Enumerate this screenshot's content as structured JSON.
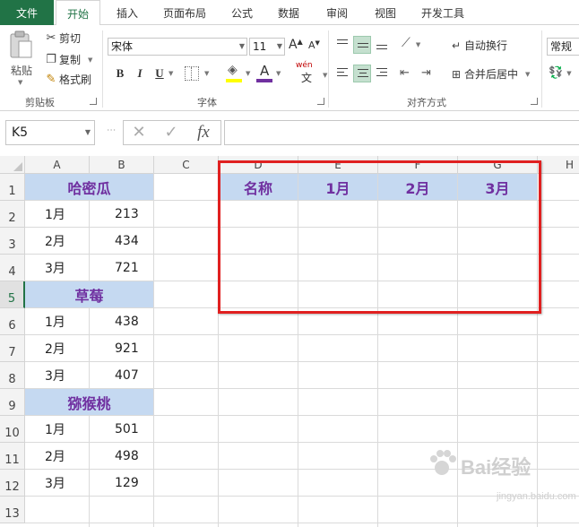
{
  "tabs": [
    "文件",
    "开始",
    "插入",
    "页面布局",
    "公式",
    "数据",
    "审阅",
    "视图",
    "开发工具"
  ],
  "clipboard": {
    "paste": "粘贴",
    "cut": "剪切",
    "copy": "复制",
    "format_painter": "格式刷",
    "label": "剪贴板"
  },
  "font": {
    "name": "宋体",
    "size": "11",
    "grow": "A",
    "shrink": "A",
    "bold": "B",
    "italic": "I",
    "underline": "U",
    "font_color_letter": "A",
    "wen": "wén",
    "wen_char": "文",
    "label": "字体",
    "font_color": "#7030a0"
  },
  "alignment": {
    "wrap_text": "自动换行",
    "merge_center": "合并后居中",
    "label": "对齐方式"
  },
  "number": {
    "format": "常规"
  },
  "formula_bar": {
    "name_box": "K5",
    "cancel": "✕",
    "enter": "✓",
    "fx": "fx",
    "content": ""
  },
  "columns": [
    "A",
    "B",
    "C",
    "D",
    "E",
    "F",
    "G",
    "H"
  ],
  "rows": [
    "1",
    "2",
    "3",
    "4",
    "5",
    "6",
    "7",
    "8",
    "9",
    "10",
    "11",
    "12",
    "13"
  ],
  "active_row": "5",
  "blocks": [
    {
      "title": "哈密瓜",
      "rows": [
        [
          "1月",
          "213"
        ],
        [
          "2月",
          "434"
        ],
        [
          "3月",
          "721"
        ]
      ]
    },
    {
      "title": "草莓",
      "rows": [
        [
          "1月",
          "438"
        ],
        [
          "2月",
          "921"
        ],
        [
          "3月",
          "407"
        ]
      ]
    },
    {
      "title": "猕猴桃",
      "rows": [
        [
          "1月",
          "501"
        ],
        [
          "2月",
          "498"
        ],
        [
          "3月",
          "129"
        ]
      ]
    }
  ],
  "target_header": [
    "名称",
    "1月",
    "2月",
    "3月"
  ],
  "colors": {
    "header_fill": "#c5d9f1",
    "header_text": "#7030a0",
    "accent": "#217346",
    "highlight_border": "#e02020"
  },
  "watermark": {
    "text": "Bai经验",
    "sub": "jingyan.baidu.com"
  }
}
